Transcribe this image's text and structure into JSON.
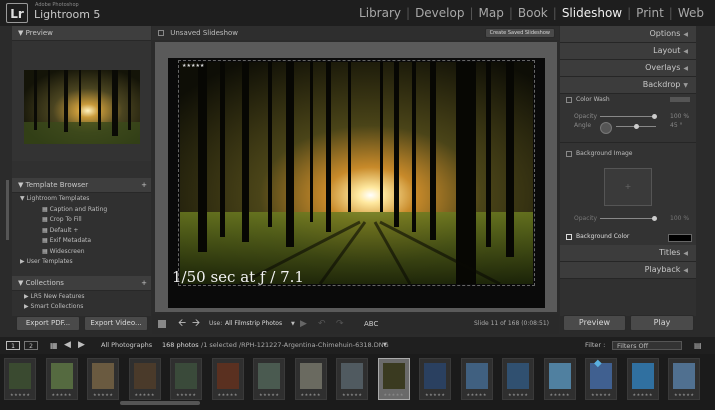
{
  "app": {
    "small_title": "Adobe Photoshop",
    "title": "Lightroom 5",
    "logo": "Lr"
  },
  "modules": [
    {
      "label": "Library",
      "active": false
    },
    {
      "label": "Develop",
      "active": false
    },
    {
      "label": "Map",
      "active": false
    },
    {
      "label": "Book",
      "active": false
    },
    {
      "label": "Slideshow",
      "active": true
    },
    {
      "label": "Print",
      "active": false
    },
    {
      "label": "Web",
      "active": false
    }
  ],
  "left_panel": {
    "preview_title": "Preview",
    "template_browser_title": "Template Browser",
    "templates_folder": "Lightroom Templates",
    "templates": [
      "Caption and Rating",
      "Crop To Fill",
      "Default +",
      "Exif Metadata",
      "Widescreen"
    ],
    "user_templates": "User Templates",
    "collections_title": "Collections",
    "collections": [
      "LR5 New Features",
      "Smart Collections"
    ],
    "export_pdf": "Export PDF...",
    "export_video": "Export Video..."
  },
  "center": {
    "title": "Unsaved Slideshow",
    "create_button": "Create Saved Slideshow",
    "stars": "★★★★★",
    "caption": "1/50 sec at ƒ / 7.1",
    "use_label": "Use:",
    "use_value": "All Filmstrip Photos",
    "abc": "ABC",
    "slide_info": "Slide 11 of 168 (0:08:51)"
  },
  "right_panel": {
    "sections": [
      "Options",
      "Layout",
      "Overlays",
      "Backdrop"
    ],
    "color_wash": "Color Wash",
    "opacity_label": "Opacity",
    "opacity_value": "100 %",
    "angle_label": "Angle",
    "angle_value": "45 °",
    "background_image": "Background Image",
    "bg_opacity_value": "100 %",
    "background_color": "Background Color",
    "titles": "Titles",
    "playback": "Playback",
    "preview_button": "Preview",
    "play_button": "Play"
  },
  "filmstrip_bar": {
    "page1": "1",
    "page2": "2",
    "source": "All Photographs",
    "count": "168 photos",
    "selection": "/1 selected /RPH-121227-Argentina-Chimehuin-6318.DNG",
    "filter_label": "Filter :",
    "filter_value": "Filters Off"
  },
  "thumbnails": [
    {
      "color": "#3a4a30"
    },
    {
      "color": "#556a40"
    },
    {
      "color": "#6a5a40"
    },
    {
      "color": "#4a3a2a"
    },
    {
      "color": "#3a4a3a"
    },
    {
      "color": "#5a3020"
    },
    {
      "color": "#4a5a50"
    },
    {
      "color": "#6a6a60"
    },
    {
      "color": "#505a60"
    },
    {
      "color": "#3a3a20"
    },
    {
      "color": "#2a4060"
    },
    {
      "color": "#406080"
    },
    {
      "color": "#305070"
    },
    {
      "color": "#5080a0"
    },
    {
      "color": "#406090"
    },
    {
      "color": "#3070a0"
    },
    {
      "color": "#507090"
    }
  ],
  "thumb_stars": "★★★★★",
  "colors": {
    "accent": "#f0f0f0",
    "panel": "#303030",
    "background": "#2b2b2b"
  }
}
